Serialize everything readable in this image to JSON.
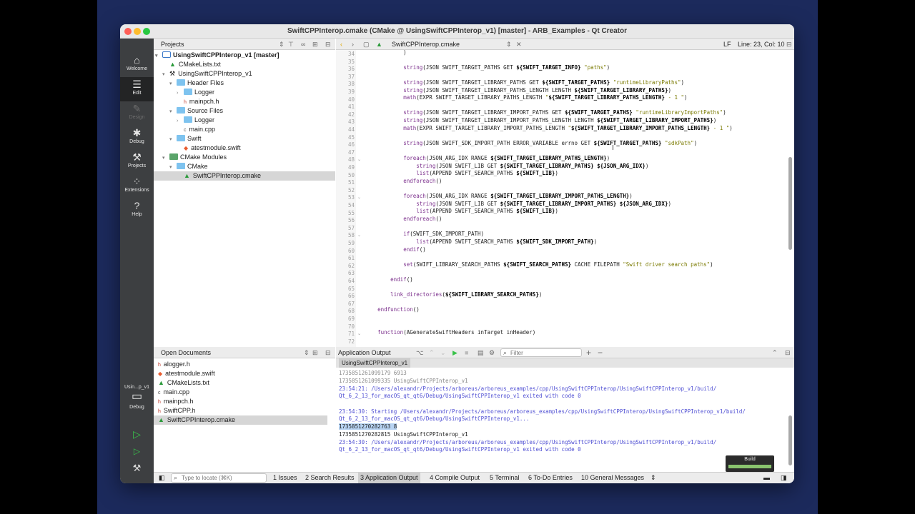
{
  "window": {
    "title": "SwiftCPPInterop.cmake (CMake @ UsingSwiftCPPInterop_v1) [master] - ARB_Examples - Qt Creator"
  },
  "modes": [
    {
      "label": "Welcome",
      "icon": "home-icon"
    },
    {
      "label": "Edit",
      "icon": "edit-icon"
    },
    {
      "label": "Design",
      "icon": "design-icon"
    },
    {
      "label": "Debug",
      "icon": "debug-icon"
    },
    {
      "label": "Projects",
      "icon": "projects-icon"
    },
    {
      "label": "Extensions",
      "icon": "extensions-icon"
    },
    {
      "label": "Help",
      "icon": "help-icon"
    }
  ],
  "kit": {
    "project": "Usin...p_v1",
    "config": "Debug"
  },
  "projects": {
    "header": "Projects",
    "items": [
      {
        "label": "UsingSwiftCPPInterop_v1 [master]"
      },
      {
        "label": "CMakeLists.txt"
      },
      {
        "label": "UsingSwiftCPPInterop_v1"
      },
      {
        "label": "Header Files"
      },
      {
        "label": "Logger"
      },
      {
        "label": "mainpch.h"
      },
      {
        "label": "Source Files"
      },
      {
        "label": "Logger"
      },
      {
        "label": "main.cpp"
      },
      {
        "label": "Swift"
      },
      {
        "label": "atestmodule.swift"
      },
      {
        "label": "CMake Modules"
      },
      {
        "label": "CMake"
      },
      {
        "label": "SwiftCPPInterop.cmake"
      }
    ]
  },
  "editor": {
    "file": "SwiftCPPInterop.cmake",
    "line_ending": "LF",
    "position": "Line: 23, Col: 10",
    "line_numbers": [
      "34",
      "35",
      "36",
      "37",
      "38",
      "39",
      "40",
      "41",
      "42",
      "43",
      "44",
      "45",
      "46",
      "47",
      "48",
      "49",
      "50",
      "51",
      "52",
      "53",
      "54",
      "55",
      "56",
      "57",
      "58",
      "59",
      "60",
      "61",
      "62",
      "63",
      "64",
      "65",
      "66",
      "67",
      "68",
      "69",
      "70",
      "71",
      "72"
    ]
  },
  "open_documents": {
    "header": "Open Documents",
    "items": [
      "alogger.h",
      "atestmodule.swift",
      "CMakeLists.txt",
      "main.cpp",
      "mainpch.h",
      "SwiftCPP.h",
      "SwiftCPPInterop.cmake"
    ]
  },
  "output": {
    "header": "Application Output",
    "filter_placeholder": "Filter",
    "tab": "UsingSwiftCPPInterop_v1",
    "lines": [
      "1735851261099179 6913",
      "1735851261099335 UsingSwiftCPPInterop_v1",
      "23:54:21: /Users/alexandr/Projects/arboreus/arboreus_examples/cpp/UsingSwiftCPPInterop/UsingSwiftCPPInterop_v1/build/",
      "Qt_6_2_13_for_macOS_qt_qt6/Debug/UsingSwiftCPPInterop_v1 exited with code 0",
      "",
      "23:54:30: Starting /Users/alexandr/Projects/arboreus/arboreus_examples/cpp/UsingSwiftCPPInterop/UsingSwiftCPPInterop_v1/build/",
      "Qt_6_2_13_for_macOS_qt_qt6/Debug/UsingSwiftCPPInterop_v1...",
      "1735851270282763 8",
      "1735851270282815 UsingSwiftCPPInterop_v1",
      "23:54:30: /Users/alexandr/Projects/arboreus/arboreus_examples/cpp/UsingSwiftCPPInterop/UsingSwiftCPPInterop_v1/build/",
      "Qt_6_2_13_for_macOS_qt_qt6/Debug/UsingSwiftCPPInterop_v1 exited with code 0"
    ],
    "build_label": "Build"
  },
  "statusbar": {
    "locate_placeholder": "Type to locate (⌘K)",
    "items": [
      "1  Issues",
      "2  Search Results",
      "3  Application Output",
      "4  Compile Output",
      "5  Terminal",
      "6  To-Do Entries",
      "10  General Messages"
    ]
  }
}
